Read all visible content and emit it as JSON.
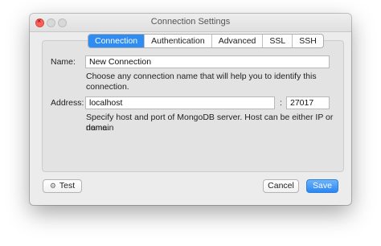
{
  "window": {
    "title": "Connection Settings"
  },
  "tabs": [
    {
      "label": "Connection",
      "active": true
    },
    {
      "label": "Authentication",
      "active": false
    },
    {
      "label": "Advanced",
      "active": false
    },
    {
      "label": "SSL",
      "active": false
    },
    {
      "label": "SSH",
      "active": false
    }
  ],
  "name": {
    "label": "Name:",
    "value": "New Connection",
    "help": "Choose any connection name that will help you to identify this connection."
  },
  "address": {
    "label": "Address:",
    "host": "localhost",
    "separator": ":",
    "port": "27017",
    "help_line1": "Specify host and port of MongoDB server. Host can be either IP or domain",
    "help_line2": "name."
  },
  "footer": {
    "test_label": "Test",
    "cancel_label": "Cancel",
    "save_label": "Save"
  },
  "colors": {
    "accent": "#2f8cf2",
    "close": "#fc605b"
  },
  "icons": {
    "test": "gear-icon"
  }
}
